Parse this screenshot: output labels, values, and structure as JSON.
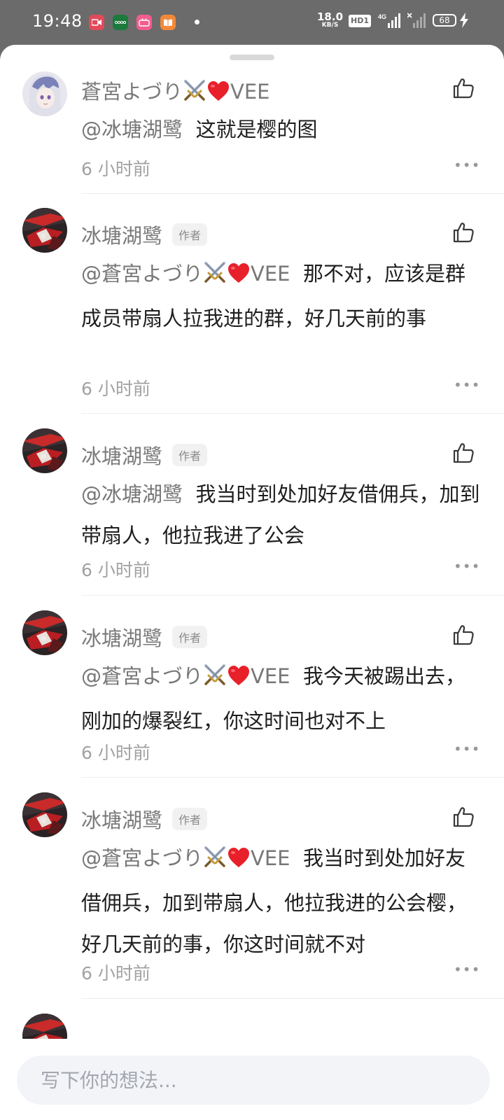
{
  "status_bar": {
    "time": "19:48",
    "net_speed_value": "18.0",
    "net_speed_unit": "KB/S",
    "hd_label": "HD1",
    "network_label": "4G",
    "battery": "68",
    "app_icons": [
      "video-recorder-app-icon",
      "oppo-app-icon",
      "bilibili-app-icon",
      "book-reader-app-icon"
    ]
  },
  "comments": [
    {
      "author": "蒼宮よづり",
      "author_suffix": "VEE",
      "is_author": false,
      "mention": "@冰塘湖鹭",
      "mention_suffix": "",
      "body": "这就是樱的图",
      "time": "6 小时前",
      "avatar": "white-haired-character-avatar"
    },
    {
      "author": "冰塘湖鹭",
      "author_suffix": "",
      "is_author": true,
      "badge": "作者",
      "mention": "@蒼宮よづり",
      "mention_suffix": "VEE",
      "body": "那不对，应该是群成员带扇人拉我进的群，好几天前的事",
      "time": "6 小时前",
      "avatar": "red-dark-character-avatar"
    },
    {
      "author": "冰塘湖鹭",
      "author_suffix": "",
      "is_author": true,
      "badge": "作者",
      "mention": "@冰塘湖鹭",
      "mention_suffix": "",
      "body": "我当时到处加好友借佣兵，加到带扇人，他拉我进了公会",
      "time": "6 小时前",
      "avatar": "red-dark-character-avatar"
    },
    {
      "author": "冰塘湖鹭",
      "author_suffix": "",
      "is_author": true,
      "badge": "作者",
      "mention": "@蒼宮よづり",
      "mention_suffix": "VEE",
      "body": "我今天被踢出去，刚加的爆裂红，你这时间也对不上",
      "time": "6 小时前",
      "avatar": "red-dark-character-avatar"
    },
    {
      "author": "冰塘湖鹭",
      "author_suffix": "",
      "is_author": true,
      "badge": "作者",
      "mention": "@蒼宮よづり",
      "mention_suffix": "VEE",
      "body": "我当时到处加好友借佣兵，加到带扇人，他拉我进的公会樱，好几天前的事，你这时间就不对",
      "time": "6 小时前",
      "avatar": "red-dark-character-avatar"
    }
  ],
  "more_glyph": "•••",
  "composer": {
    "placeholder": "写下你的想法..."
  },
  "colors": {
    "status_bar_bg": "#6b6b6b",
    "heart": "#e8202a",
    "sword": "#7d8ea8"
  }
}
